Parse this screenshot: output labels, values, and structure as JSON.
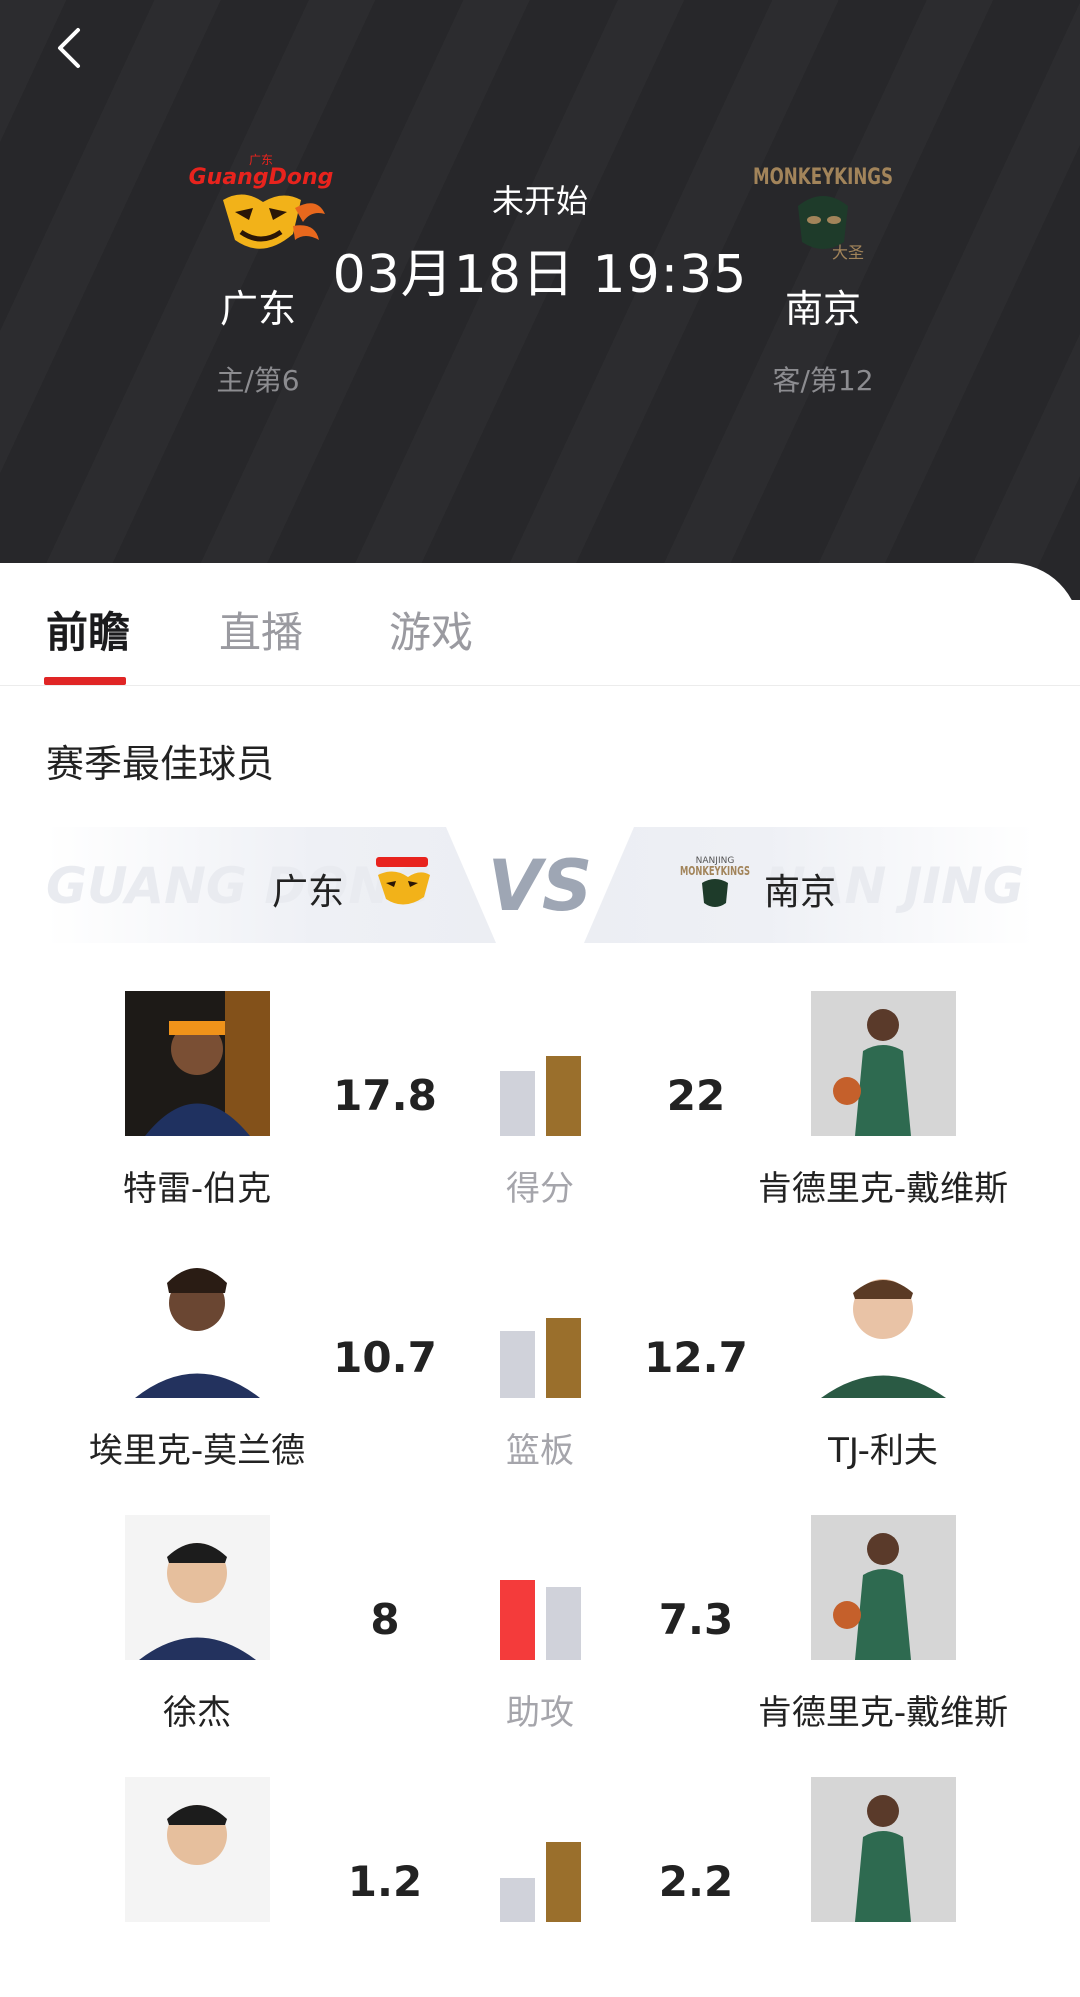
{
  "match": {
    "status": "未开始",
    "datetime": "03月18日 19:35",
    "home": {
      "name": "广东",
      "rank": "主/第6",
      "logo_text": "GuangDong",
      "logo_sub": "广东"
    },
    "away": {
      "name": "南京",
      "rank": "客/第12",
      "logo_text": "MONKEYKINGS",
      "logo_sub": "大圣"
    }
  },
  "tabs": [
    {
      "label": "前瞻",
      "active": true
    },
    {
      "label": "直播",
      "active": false
    },
    {
      "label": "游戏",
      "active": false
    }
  ],
  "section": {
    "title": "赛季最佳球员"
  },
  "vs": {
    "label": "VS",
    "home_name": "广东",
    "home_ghost": "GUANG DONG",
    "away_name": "南京",
    "away_ghost": "NAN JING",
    "away_logo_top": "NANJING",
    "away_logo_text": "MONKEYKINGS"
  },
  "colors": {
    "home_bar_win": "#f43b3b",
    "away_bar_win": "#9a6f2c",
    "bar_lose": "#d0d2da",
    "tab_accent": "#e02525"
  },
  "stats": [
    {
      "label": "得分",
      "home_player": "特雷-伯克",
      "home_value": "17.8",
      "away_player": "肯德里克-戴维斯",
      "away_value": "22",
      "home_num": 17.8,
      "away_num": 22
    },
    {
      "label": "篮板",
      "home_player": "埃里克-莫兰德",
      "home_value": "10.7",
      "away_player": "TJ-利夫",
      "away_value": "12.7",
      "home_num": 10.7,
      "away_num": 12.7
    },
    {
      "label": "助攻",
      "home_player": "徐杰",
      "home_value": "8",
      "away_player": "肯德里克-戴维斯",
      "away_value": "7.3",
      "home_num": 8,
      "away_num": 7.3
    },
    {
      "label": "",
      "home_player": "",
      "home_value": "1.2",
      "away_player": "",
      "away_value": "2.2",
      "home_num": 1.2,
      "away_num": 2.2
    }
  ]
}
